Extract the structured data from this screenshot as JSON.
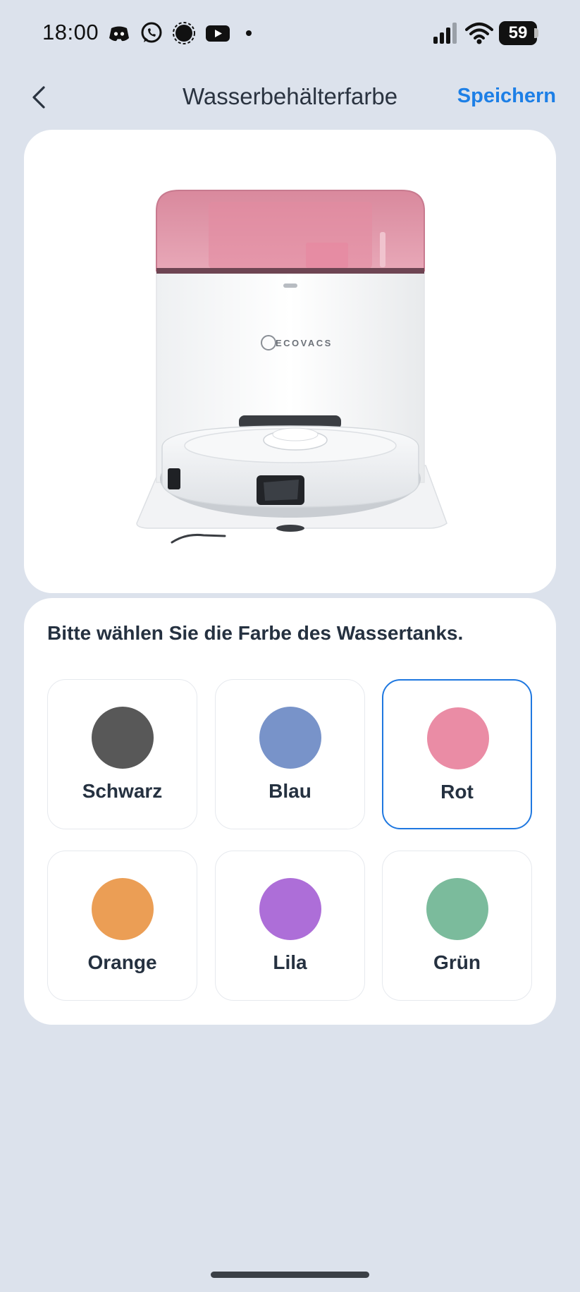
{
  "status_bar": {
    "time": "18:00",
    "battery": "59",
    "icons": [
      "discord-icon",
      "whatsapp-icon",
      "signal-icon",
      "youtube-icon",
      "more-dot-icon",
      "cell-signal-icon",
      "wifi-icon",
      "battery-icon"
    ]
  },
  "header": {
    "title": "Wasserbehälterfarbe",
    "save_label": "Speichern",
    "back_icon": "chevron-left-icon"
  },
  "product": {
    "brand_text": "ECOVACS",
    "tank_color": "#e89aa8"
  },
  "color_picker": {
    "instruction": "Bitte wählen Sie die Farbe des Wassertanks.",
    "selected": "Rot",
    "options": [
      {
        "label": "Schwarz",
        "color": "#585858"
      },
      {
        "label": "Blau",
        "color": "#7893c9"
      },
      {
        "label": "Rot",
        "color": "#ea8ca5"
      },
      {
        "label": "Orange",
        "color": "#eb9e55"
      },
      {
        "label": "Lila",
        "color": "#ad6ed8"
      },
      {
        "label": "Grün",
        "color": "#7bbb9c"
      }
    ]
  },
  "colors": {
    "background": "#dce2ec",
    "accent": "#1d7fe6",
    "card": "#ffffff"
  }
}
